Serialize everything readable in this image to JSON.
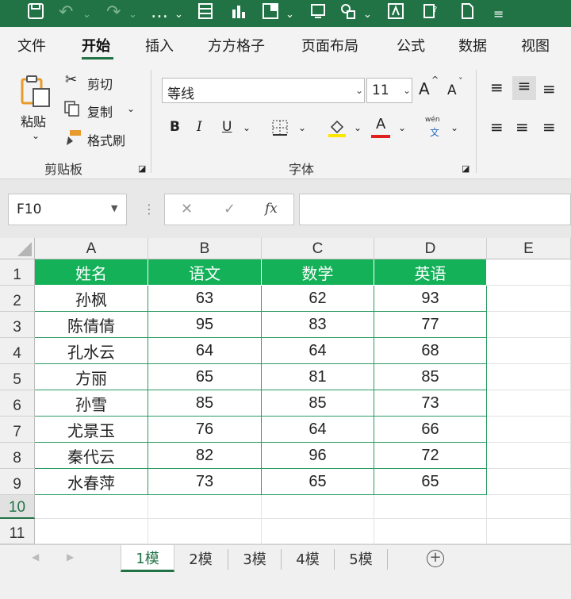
{
  "menu": {
    "tabs": [
      "文件",
      "开始",
      "插入",
      "方方格子",
      "页面布局",
      "公式",
      "数据",
      "视图"
    ],
    "active_tab": "开始"
  },
  "ribbon": {
    "clipboard": {
      "paste": "粘贴",
      "cut": "剪切",
      "copy": "复制",
      "format_painter": "格式刷",
      "group_label": "剪贴板"
    },
    "font": {
      "font_name": "等线",
      "font_size": "11",
      "bold": "B",
      "italic": "I",
      "underline": "U",
      "font_color_letter": "A",
      "grow_font": "A",
      "shrink_font": "A",
      "phonetic_top": "wén",
      "phonetic_bottom": "文",
      "group_label": "字体",
      "highlight_color": "#ffe600",
      "font_color": "#e01f1f"
    }
  },
  "formula_bar": {
    "name_box": "F10",
    "cancel_symbol": "✕",
    "enter_symbol": "✓",
    "fx_label": "fx",
    "formula": ""
  },
  "sheet": {
    "columns": [
      "A",
      "B",
      "C",
      "D",
      "E"
    ],
    "rows": [
      "1",
      "2",
      "3",
      "4",
      "5",
      "6",
      "7",
      "8",
      "9",
      "10",
      "11"
    ],
    "selected_row": "10",
    "header": [
      "姓名",
      "语文",
      "数学",
      "英语"
    ],
    "data": [
      [
        "孙枫",
        "63",
        "62",
        "93"
      ],
      [
        "陈倩倩",
        "95",
        "83",
        "77"
      ],
      [
        "孔水云",
        "64",
        "64",
        "68"
      ],
      [
        "方丽",
        "65",
        "81",
        "85"
      ],
      [
        "孙雪",
        "85",
        "85",
        "73"
      ],
      [
        "尤景玉",
        "76",
        "64",
        "66"
      ],
      [
        "秦代云",
        "82",
        "96",
        "72"
      ],
      [
        "水春萍",
        "73",
        "65",
        "65"
      ]
    ],
    "header_color": "#14b159",
    "accent": "#217346"
  },
  "sheet_tabs": {
    "tabs": [
      "1模",
      "2模",
      "3模",
      "4模",
      "5模"
    ],
    "active": "1模",
    "add_symbol": "+"
  }
}
